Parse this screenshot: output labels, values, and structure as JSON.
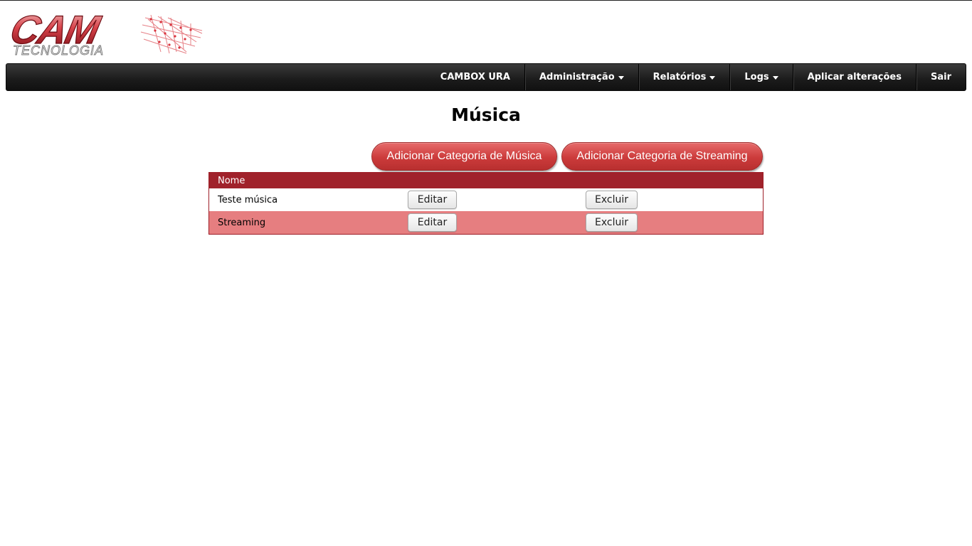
{
  "logo": {
    "brand_text": "CAM",
    "sub_text": "TECNOLOGIA"
  },
  "navbar": {
    "items": [
      {
        "label": "CAMBOX URA",
        "dropdown": false
      },
      {
        "label": "Administração",
        "dropdown": true
      },
      {
        "label": "Relatórios",
        "dropdown": true
      },
      {
        "label": "Logs",
        "dropdown": true
      },
      {
        "label": "Aplicar alterações",
        "dropdown": false
      },
      {
        "label": "Sair",
        "dropdown": false
      }
    ]
  },
  "page": {
    "title": "Música"
  },
  "actions": {
    "add_music_category": "Adicionar Categoria de Música",
    "add_streaming_category": "Adicionar Categoria de Streaming"
  },
  "table": {
    "header": "Nome",
    "rows": [
      {
        "name": "Teste música",
        "edit_label": "Editar",
        "delete_label": "Excluir"
      },
      {
        "name": "Streaming",
        "edit_label": "Editar",
        "delete_label": "Excluir"
      }
    ]
  },
  "colors": {
    "accent_red": "#a0222b",
    "row_alt": "#e67e80",
    "navbar_dark": "#1b1b1b"
  }
}
